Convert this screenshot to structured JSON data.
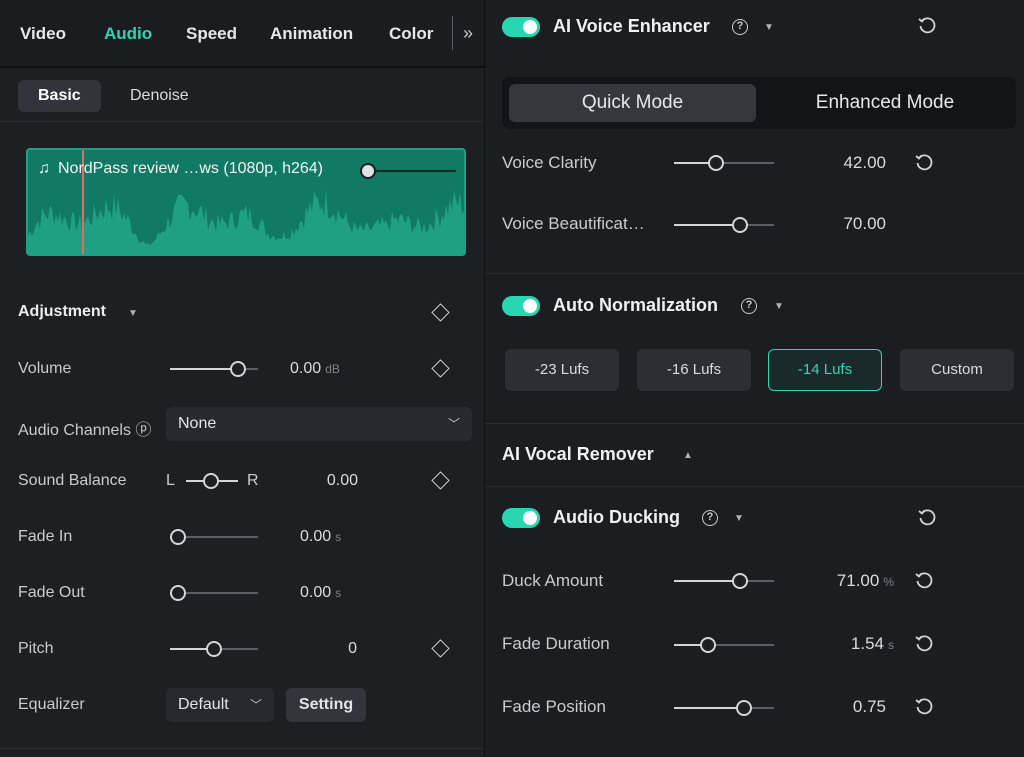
{
  "tabs": [
    "Video",
    "Audio",
    "Speed",
    "Animation",
    "Color"
  ],
  "active_tab": "Audio",
  "more_label": "»",
  "subtabs": [
    "Basic",
    "Denoise"
  ],
  "clip": {
    "title": "NordPass review …ws (1080p, h264)",
    "icon": "music-note-icon"
  },
  "adjustment": {
    "title": "Adjustment",
    "volume": {
      "label": "Volume",
      "value": "0.00",
      "unit": "dB",
      "level": 0.75
    },
    "channels": {
      "label": "Audio Channels",
      "value": "None"
    },
    "balance": {
      "label": "Sound Balance",
      "left": "L",
      "right": "R",
      "value": "0.00",
      "level": 0.5
    },
    "fade_in": {
      "label": "Fade In",
      "value": "0.00",
      "unit": "s",
      "level": 0
    },
    "fade_out": {
      "label": "Fade Out",
      "value": "0.00",
      "unit": "s",
      "level": 0
    },
    "pitch": {
      "label": "Pitch",
      "value": "0",
      "level": 0.5
    },
    "equalizer": {
      "label": "Equalizer",
      "value": "Default",
      "button": "Setting"
    }
  },
  "voice_enhancer": {
    "title": "AI Voice Enhancer",
    "enabled": true,
    "modes": [
      "Quick Mode",
      "Enhanced Mode"
    ],
    "active_mode": "Quick Mode",
    "clarity": {
      "label": "Voice Clarity",
      "value": "42.00",
      "level": 0.42
    },
    "beautification": {
      "label": "Voice Beautificat…",
      "value": "70.00",
      "level": 0.7
    }
  },
  "normalization": {
    "title": "Auto Normalization",
    "enabled": true,
    "options": [
      "-23 Lufs",
      "-16 Lufs",
      "-14 Lufs",
      "Custom"
    ],
    "active": "-14 Lufs"
  },
  "vocal_remover": {
    "title": "AI Vocal Remover"
  },
  "ducking": {
    "title": "Audio Ducking",
    "enabled": true,
    "amount": {
      "label": "Duck Amount",
      "value": "71.00",
      "unit": "%",
      "level": 0.71
    },
    "duration": {
      "label": "Fade Duration",
      "value": "1.54",
      "unit": "s",
      "level": 0.35
    },
    "position": {
      "label": "Fade Position",
      "value": "0.75",
      "level": 0.75
    }
  },
  "colors": {
    "accent": "#2fd4b4",
    "waveform": "#107a64",
    "playhead": "#e76a6a"
  }
}
